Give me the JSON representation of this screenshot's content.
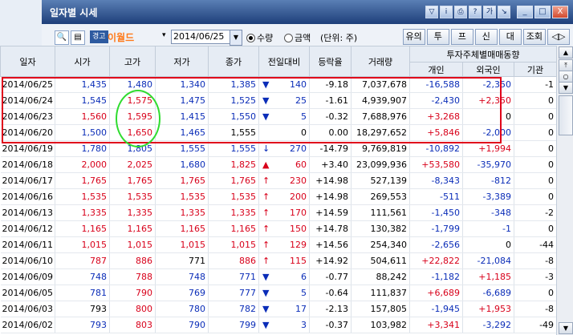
{
  "window": {
    "title": "일자별 시세",
    "title_icons": [
      "filter-icon",
      "info-icon",
      "print-icon",
      "help-icon",
      "link-icon",
      "pin-icon"
    ],
    "title_icon_glyphs": [
      "▽",
      "i",
      "⎙",
      "?",
      "가",
      "↘"
    ],
    "win_btns": [
      "_",
      "□",
      "X"
    ]
  },
  "toolbar": {
    "search_icon": "🔍",
    "list_icon": "▤",
    "badge": "경고",
    "stock_name": "이월드",
    "dropdown_arrow": "▾",
    "date": "2014/06/25",
    "cal_arrow": "▼",
    "radio_qty": "수량",
    "radio_amt": "금액",
    "unit": "(단위: 주)",
    "right_buttons": [
      "유의",
      "투",
      "프",
      "신",
      "대",
      "조회",
      "◁▷"
    ]
  },
  "table": {
    "headers": {
      "date": "일자",
      "open": "시가",
      "high": "고가",
      "low": "저가",
      "close": "종가",
      "change": "전일대비",
      "rate": "등락율",
      "volume": "거래량",
      "investor_group": "투자주체별매매동향",
      "individual": "개인",
      "foreign": "외국인",
      "inst": "기관"
    },
    "rows": [
      {
        "date": "2014/06/25",
        "open": "1,435",
        "high": "1,480",
        "low": "1,340",
        "close": "1,385",
        "change_sym": "▼",
        "change": "140",
        "rate": "-9.18",
        "volume": "7,037,678",
        "individual": "-16,588",
        "foreign": "-2,350",
        "inst": "-1",
        "c_open": "down",
        "c_high": "down",
        "c_low": "down",
        "c_close": "down",
        "c_change": "down",
        "c_ind": "down",
        "c_for": "down"
      },
      {
        "date": "2014/06/24",
        "open": "1,545",
        "high": "1,575",
        "low": "1,475",
        "close": "1,525",
        "change_sym": "▼",
        "change": "25",
        "rate": "-1.61",
        "volume": "4,939,907",
        "individual": "-2,430",
        "foreign": "+2,350",
        "inst": "0",
        "c_open": "down",
        "c_high": "up",
        "c_low": "down",
        "c_close": "down",
        "c_change": "down",
        "c_ind": "down",
        "c_for": "up"
      },
      {
        "date": "2014/06/23",
        "open": "1,560",
        "high": "1,595",
        "low": "1,415",
        "close": "1,550",
        "change_sym": "▼",
        "change": "5",
        "rate": "-0.32",
        "volume": "7,688,976",
        "individual": "+3,268",
        "foreign": "0",
        "inst": "0",
        "c_open": "up",
        "c_high": "up",
        "c_low": "down",
        "c_close": "down",
        "c_change": "down",
        "c_ind": "up",
        "c_for": "blk"
      },
      {
        "date": "2014/06/20",
        "open": "1,500",
        "high": "1,650",
        "low": "1,465",
        "close": "1,555",
        "change_sym": "",
        "change": "0",
        "rate": "0.00",
        "volume": "18,297,652",
        "individual": "+5,846",
        "foreign": "-2,000",
        "inst": "0",
        "c_open": "down",
        "c_high": "up",
        "c_low": "down",
        "c_close": "blk",
        "c_change": "blk",
        "c_ind": "up",
        "c_for": "down"
      },
      {
        "date": "2014/06/19",
        "open": "1,780",
        "high": "1,805",
        "low": "1,555",
        "close": "1,555",
        "change_sym": "↓",
        "change": "270",
        "rate": "-14.79",
        "volume": "9,769,819",
        "individual": "-10,892",
        "foreign": "+1,994",
        "inst": "0",
        "c_open": "down",
        "c_high": "down",
        "c_low": "down",
        "c_close": "down",
        "c_change": "down",
        "c_ind": "down",
        "c_for": "up"
      },
      {
        "date": "2014/06/18",
        "open": "2,000",
        "high": "2,025",
        "low": "1,680",
        "close": "1,825",
        "change_sym": "▲",
        "change": "60",
        "rate": "+3.40",
        "volume": "23,099,936",
        "individual": "+53,580",
        "foreign": "-35,970",
        "inst": "0",
        "c_open": "up",
        "c_high": "up",
        "c_low": "down",
        "c_close": "up",
        "c_change": "up",
        "c_ind": "up",
        "c_for": "down"
      },
      {
        "date": "2014/06/17",
        "open": "1,765",
        "high": "1,765",
        "low": "1,765",
        "close": "1,765",
        "change_sym": "↑",
        "change": "230",
        "rate": "+14.98",
        "volume": "527,139",
        "individual": "-8,343",
        "foreign": "-812",
        "inst": "0",
        "c_open": "up",
        "c_high": "up",
        "c_low": "up",
        "c_close": "up",
        "c_change": "up",
        "c_ind": "down",
        "c_for": "down"
      },
      {
        "date": "2014/06/16",
        "open": "1,535",
        "high": "1,535",
        "low": "1,535",
        "close": "1,535",
        "change_sym": "↑",
        "change": "200",
        "rate": "+14.98",
        "volume": "269,553",
        "individual": "-511",
        "foreign": "-3,389",
        "inst": "0",
        "c_open": "up",
        "c_high": "up",
        "c_low": "up",
        "c_close": "up",
        "c_change": "up",
        "c_ind": "down",
        "c_for": "down"
      },
      {
        "date": "2014/06/13",
        "open": "1,335",
        "high": "1,335",
        "low": "1,335",
        "close": "1,335",
        "change_sym": "↑",
        "change": "170",
        "rate": "+14.59",
        "volume": "111,561",
        "individual": "-1,450",
        "foreign": "-348",
        "inst": "-2",
        "c_open": "up",
        "c_high": "up",
        "c_low": "up",
        "c_close": "up",
        "c_change": "up",
        "c_ind": "down",
        "c_for": "down"
      },
      {
        "date": "2014/06/12",
        "open": "1,165",
        "high": "1,165",
        "low": "1,165",
        "close": "1,165",
        "change_sym": "↑",
        "change": "150",
        "rate": "+14.78",
        "volume": "130,382",
        "individual": "-1,799",
        "foreign": "-1",
        "inst": "0",
        "c_open": "up",
        "c_high": "up",
        "c_low": "up",
        "c_close": "up",
        "c_change": "up",
        "c_ind": "down",
        "c_for": "down"
      },
      {
        "date": "2014/06/11",
        "open": "1,015",
        "high": "1,015",
        "low": "1,015",
        "close": "1,015",
        "change_sym": "↑",
        "change": "129",
        "rate": "+14.56",
        "volume": "254,340",
        "individual": "-2,656",
        "foreign": "0",
        "inst": "-44",
        "c_open": "up",
        "c_high": "up",
        "c_low": "up",
        "c_close": "up",
        "c_change": "up",
        "c_ind": "down",
        "c_for": "blk"
      },
      {
        "date": "2014/06/10",
        "open": "787",
        "high": "886",
        "low": "771",
        "close": "886",
        "change_sym": "↑",
        "change": "115",
        "rate": "+14.92",
        "volume": "504,611",
        "individual": "+22,822",
        "foreign": "-21,084",
        "inst": "-8",
        "c_open": "up",
        "c_high": "up",
        "c_low": "blk",
        "c_close": "up",
        "c_change": "up",
        "c_ind": "up",
        "c_for": "down"
      },
      {
        "date": "2014/06/09",
        "open": "748",
        "high": "788",
        "low": "748",
        "close": "771",
        "change_sym": "▼",
        "change": "6",
        "rate": "-0.77",
        "volume": "88,242",
        "individual": "-1,182",
        "foreign": "+1,185",
        "inst": "-3",
        "c_open": "down",
        "c_high": "up",
        "c_low": "down",
        "c_close": "down",
        "c_change": "down",
        "c_ind": "down",
        "c_for": "up"
      },
      {
        "date": "2014/06/05",
        "open": "781",
        "high": "790",
        "low": "769",
        "close": "777",
        "change_sym": "▼",
        "change": "5",
        "rate": "-0.64",
        "volume": "111,837",
        "individual": "+6,689",
        "foreign": "-6,689",
        "inst": "0",
        "c_open": "down",
        "c_high": "up",
        "c_low": "down",
        "c_close": "down",
        "c_change": "down",
        "c_ind": "up",
        "c_for": "down"
      },
      {
        "date": "2014/06/03",
        "open": "793",
        "high": "800",
        "low": "780",
        "close": "782",
        "change_sym": "▼",
        "change": "17",
        "rate": "-2.13",
        "volume": "157,805",
        "individual": "-1,945",
        "foreign": "+1,953",
        "inst": "-8",
        "c_open": "blk",
        "c_high": "up",
        "c_low": "down",
        "c_close": "down",
        "c_change": "down",
        "c_ind": "down",
        "c_for": "up"
      },
      {
        "date": "2014/06/02",
        "open": "793",
        "high": "803",
        "low": "790",
        "close": "799",
        "change_sym": "▼",
        "change": "3",
        "rate": "-0.37",
        "volume": "103,982",
        "individual": "+3,341",
        "foreign": "-3,292",
        "inst": "-49",
        "c_open": "down",
        "c_high": "up",
        "c_low": "down",
        "c_close": "down",
        "c_change": "down",
        "c_ind": "up",
        "c_for": "down"
      }
    ]
  },
  "scrollbar": {
    "up": "▲",
    "top": "⤒",
    "mid": "○",
    "down_small": "▼",
    "down": "▼"
  },
  "colors": {
    "up": "#d8001a",
    "down": "#0b2db8",
    "highlight_box": "#e0001b",
    "highlight_oval": "#2fdc2f",
    "title_bar": "#1e3f7a"
  }
}
